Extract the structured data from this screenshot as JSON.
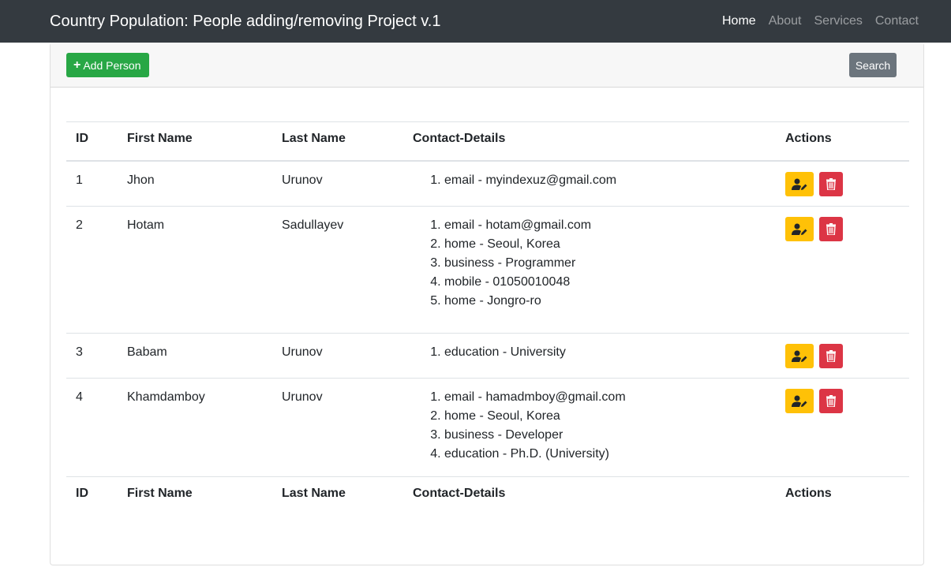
{
  "app": {
    "title": "Country Population: People adding/removing Project v.1"
  },
  "nav": {
    "items": [
      "Home",
      "About",
      "Services",
      "Contact"
    ],
    "active": "Home"
  },
  "toolbar": {
    "add_label": "Add Person",
    "search_label": "Search"
  },
  "table": {
    "headers": [
      "ID",
      "First Name",
      "Last Name",
      "Contact-Details",
      "Actions"
    ],
    "rows": [
      {
        "id": "1",
        "first": "Jhon",
        "last": "Urunov",
        "contacts": [
          "email - myindexuz@gmail.com"
        ]
      },
      {
        "id": "2",
        "first": "Hotam",
        "last": "Sadullayev",
        "contacts": [
          "email - hotam@gmail.com",
          "home - Seoul, Korea",
          "business - Programmer",
          "mobile - 01050010048",
          "home - Jongro-ro"
        ]
      },
      {
        "id": "3",
        "first": "Babam",
        "last": "Urunov",
        "contacts": [
          "education - University"
        ]
      },
      {
        "id": "4",
        "first": "Khamdamboy",
        "last": "Urunov",
        "contacts": [
          "email - hamadmboy@gmail.com",
          "home - Seoul, Korea",
          "business - Developer",
          "education - Ph.D. (University)"
        ]
      }
    ]
  },
  "colors": {
    "navbar": "#343a40",
    "add": "#28a745",
    "search": "#6c757d",
    "edit": "#ffc107",
    "delete": "#dc3545"
  },
  "icons": {
    "add": "plus-icon",
    "edit": "user-edit-icon",
    "delete": "trash-icon"
  }
}
